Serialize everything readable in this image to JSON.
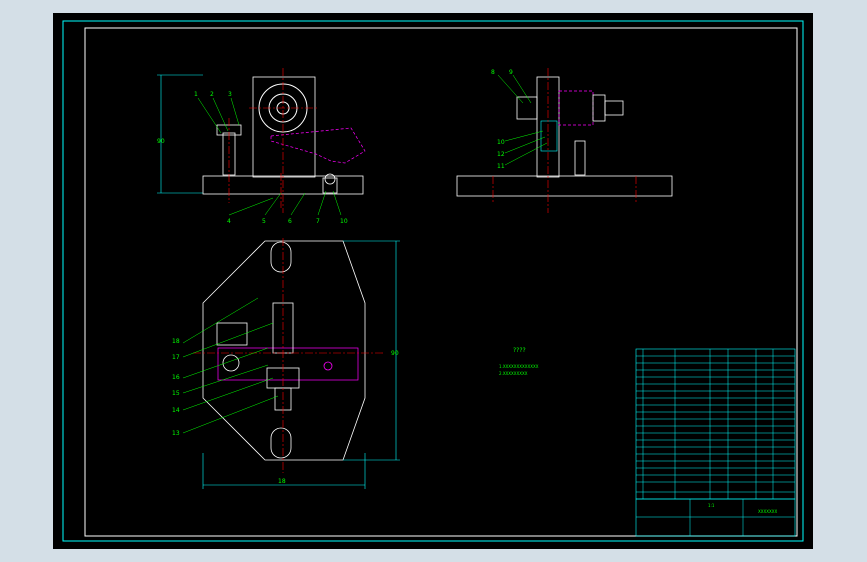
{
  "drawing": {
    "front_view_labels": [
      "1",
      "2",
      "3",
      "4",
      "5",
      "6",
      "7",
      "10"
    ],
    "side_view_labels": [
      "8",
      "9",
      "10",
      "12",
      "11"
    ],
    "top_view_labels": [
      "18",
      "17",
      "16",
      "15",
      "14",
      "13"
    ],
    "dim_label_top": "90",
    "dim_label_bottom": "18",
    "dim_label_right": "90",
    "note_title": "????",
    "note_line1": "1.XXXXXXXXXXXXX",
    "note_line2": "2.XXXXXXXXX",
    "title_block_name": "XXXXXXX",
    "title_block_scale": "1:1"
  },
  "colors": {
    "outline": "#00ffff",
    "hidden": "#ff00ff",
    "center": "#ff0000",
    "part": "#ffffff",
    "text": "#00ff00",
    "yellow": "#ffff00"
  }
}
